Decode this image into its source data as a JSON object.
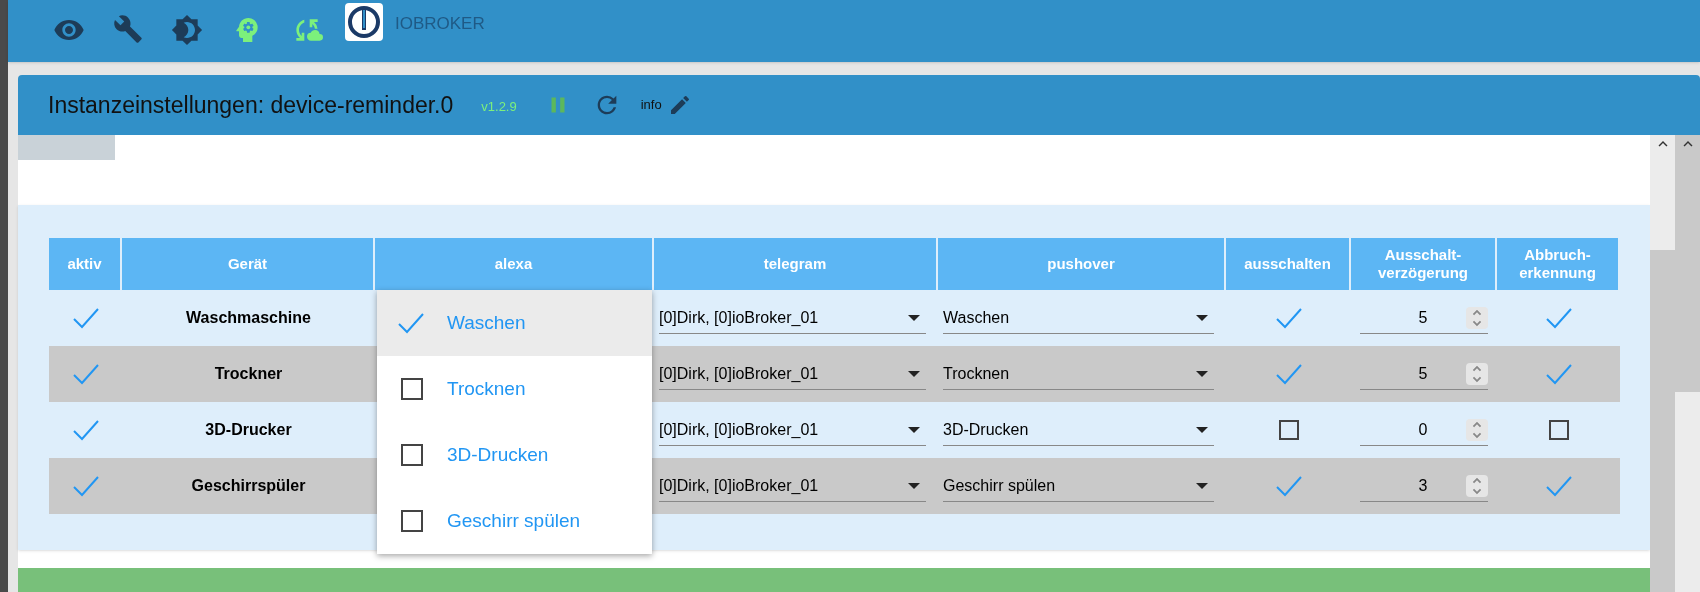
{
  "app": {
    "title": "IOBROKER"
  },
  "instance": {
    "title": "Instanzeinstellungen: device-reminder.0",
    "version": "v1.2.9",
    "info": "info"
  },
  "table": {
    "columns": [
      "aktiv",
      "Gerät",
      "alexa",
      "telegram",
      "pushover",
      "ausschalten",
      "Ausschalt-\nverzögerung",
      "Abbruch-\nerkennung"
    ],
    "rows": [
      {
        "active": true,
        "device": "Waschmaschine",
        "telegram": "[0]Dirk, [0]ioBroker_01",
        "pushover": "Waschen",
        "switch_off": true,
        "delay": "5",
        "abort_detection": true
      },
      {
        "active": true,
        "device": "Trockner",
        "telegram": "[0]Dirk, [0]ioBroker_01",
        "pushover": "Trocknen",
        "switch_off": true,
        "delay": "5",
        "abort_detection": true
      },
      {
        "active": true,
        "device": "3D-Drucker",
        "telegram": "[0]Dirk, [0]ioBroker_01",
        "pushover": "3D-Drucken",
        "switch_off": false,
        "delay": "0",
        "abort_detection": false
      },
      {
        "active": true,
        "device": "Geschirrspüler",
        "telegram": "[0]Dirk, [0]ioBroker_01",
        "pushover": "Geschirr spülen",
        "switch_off": true,
        "delay": "3",
        "abort_detection": true
      }
    ]
  },
  "alexa_menu": {
    "options": [
      {
        "label": "Waschen",
        "checked": true,
        "highlighted": true
      },
      {
        "label": "Trocknen",
        "checked": false,
        "highlighted": false
      },
      {
        "label": "3D-Drucken",
        "checked": false,
        "highlighted": false
      },
      {
        "label": "Geschirr spülen",
        "checked": false,
        "highlighted": false
      }
    ]
  }
}
